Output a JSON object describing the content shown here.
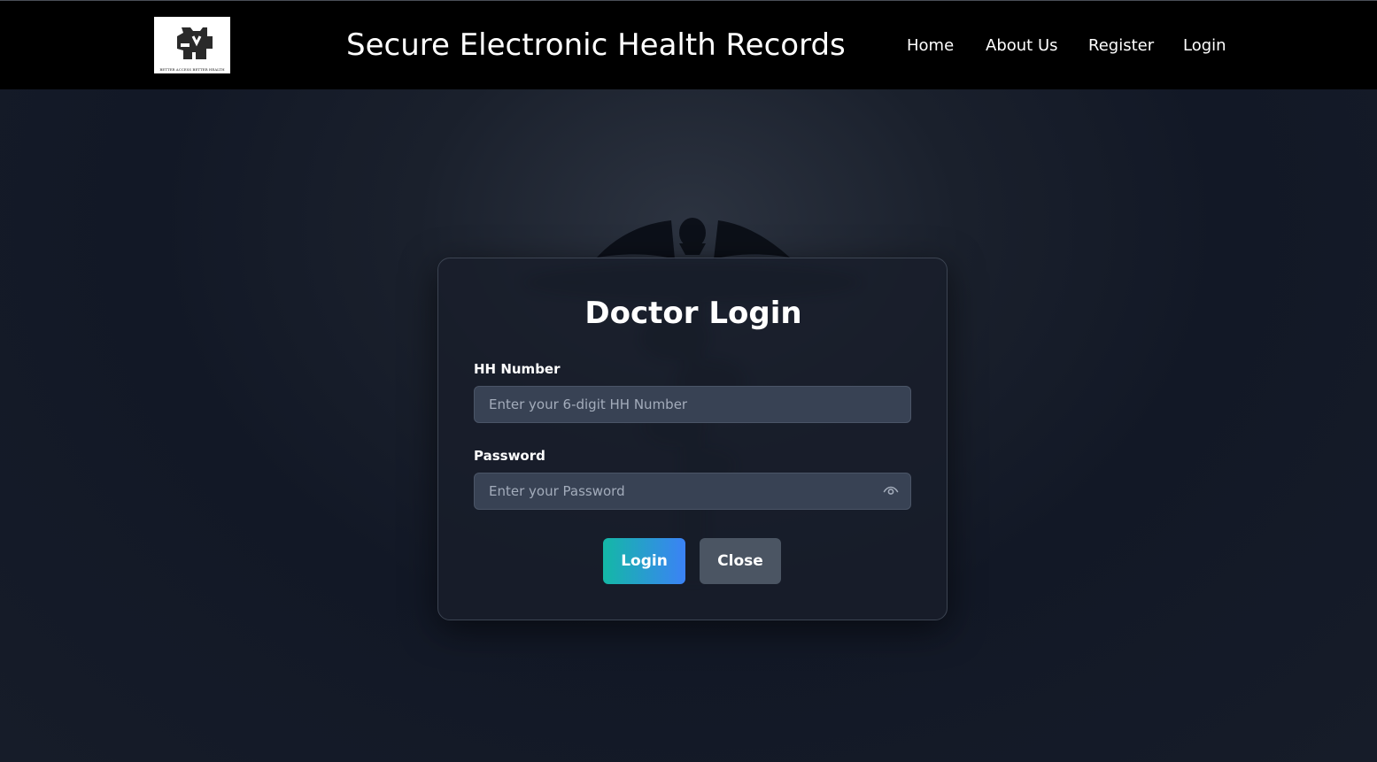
{
  "header": {
    "logo_name": "hospital-logo",
    "logo_tagline": "BETTER ACCESS BETTER HEALTH",
    "title": "Secure Electronic Health Records",
    "nav": [
      {
        "label": "Home"
      },
      {
        "label": "About Us"
      },
      {
        "label": "Register"
      },
      {
        "label": "Login"
      }
    ]
  },
  "login_form": {
    "title": "Doctor Login",
    "hh_label": "HH Number",
    "hh_placeholder": "Enter your 6-digit HH Number",
    "hh_value": "",
    "password_label": "Password",
    "password_placeholder": "Enter your Password",
    "password_value": "",
    "password_toggle_icon": "eye-icon",
    "login_button": "Login",
    "close_button": "Close"
  },
  "colors": {
    "navbar_bg": "#000000",
    "page_bg": "#121826",
    "input_bg": "#384254",
    "login_gradient_start": "#14b8a6",
    "login_gradient_end": "#3b82f6",
    "close_bg": "#4b5563"
  }
}
